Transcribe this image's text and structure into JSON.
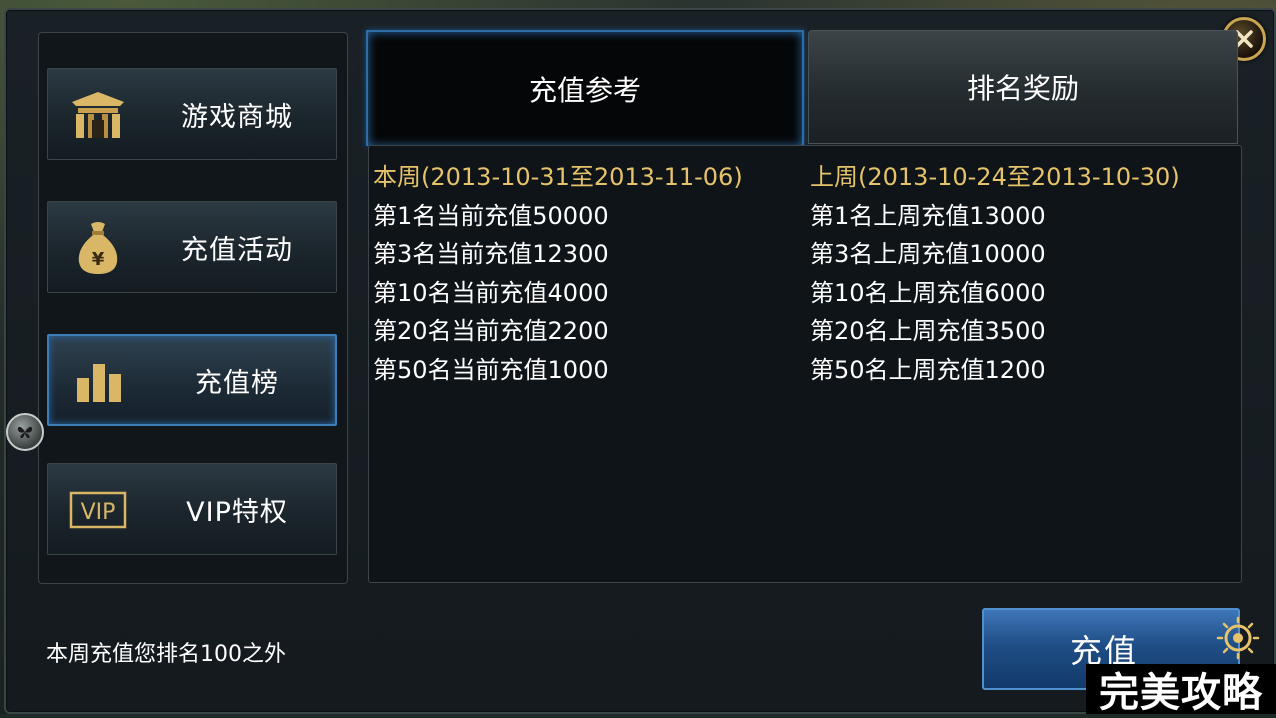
{
  "nav": {
    "items": [
      {
        "label": "游戏商城",
        "icon": "shop-gate-icon"
      },
      {
        "label": "充值活动",
        "icon": "money-bag-icon"
      },
      {
        "label": "充值榜",
        "icon": "bar-chart-icon"
      },
      {
        "label": "VIP特权",
        "icon": "vip-badge-icon",
        "icon_text": "VIP"
      }
    ],
    "active_index": 2
  },
  "tabs": [
    {
      "label": "充值参考"
    },
    {
      "label": "排名奖励"
    }
  ],
  "ranking": {
    "this_week": {
      "heading": "本周(2013-10-31至2013-11-06)",
      "rows": [
        "第1名当前充值50000",
        "第3名当前充值12300",
        "第10名当前充值4000",
        "第20名当前充值2200",
        "第50名当前充值1000"
      ]
    },
    "last_week": {
      "heading": "上周(2013-10-24至2013-10-30)",
      "rows": [
        "第1名上周充值13000",
        "第3名上周充值10000",
        "第10名上周充值6000",
        "第20名上周充值3500",
        "第50名上周充值1200"
      ]
    }
  },
  "footer": {
    "status_text": "本周充值您排名100之外",
    "recharge_label": "充值"
  },
  "watermark": "完美攻略",
  "colors": {
    "accent_blue": "#3c7db8",
    "heading_gold": "#e6c36a",
    "close_gold": "#c9a653"
  }
}
